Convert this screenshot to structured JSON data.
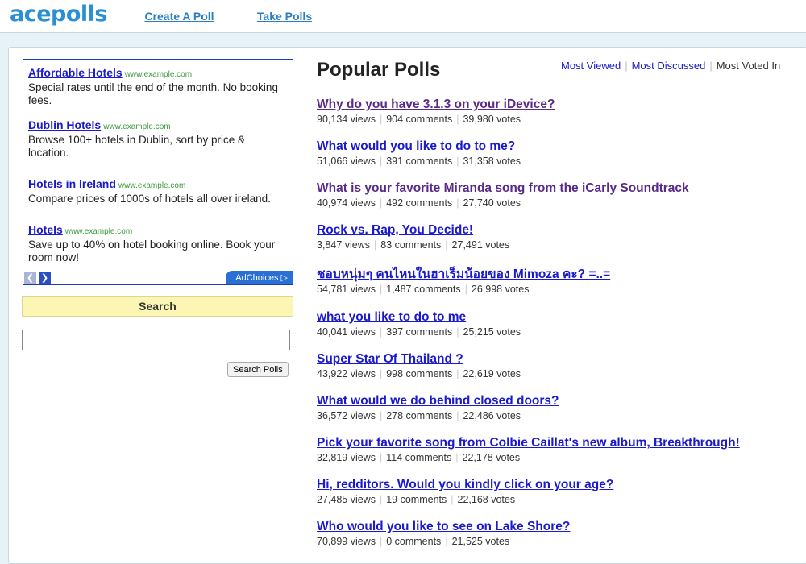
{
  "header": {
    "logo": "acepolls",
    "nav": [
      {
        "label": "Create A Poll"
      },
      {
        "label": "Take Polls"
      }
    ]
  },
  "ad": {
    "items": [
      {
        "title": "Affordable Hotels",
        "url": "www.example.com",
        "desc": "Special rates until the end of the month. No booking fees."
      },
      {
        "title": "Dublin Hotels",
        "url": "www.example.com",
        "desc": "Browse 100+ hotels in Dublin, sort by price & location."
      },
      {
        "title": "Hotels in Ireland",
        "url": "www.example.com",
        "desc": "Compare prices of 1000s of hotels all over ireland."
      },
      {
        "title": "Hotels",
        "url": "www.example.com",
        "desc": "Save up to 40% on hotel booking online. Book your room now!"
      }
    ],
    "adchoices": "AdChoices"
  },
  "search": {
    "heading": "Search",
    "input_value": "",
    "button_label": "Search Polls"
  },
  "main": {
    "title": "Popular Polls",
    "sort": {
      "most_viewed": "Most Viewed",
      "most_discussed": "Most Discussed",
      "most_voted": "Most Voted In"
    },
    "polls": [
      {
        "title": "Why do you have 3.1.3 on your iDevice?",
        "views": "90,134 views",
        "comments": "904 comments",
        "votes": "39,980 votes",
        "visited": true
      },
      {
        "title": "What would you like to do to me?",
        "views": "51,066 views",
        "comments": "391 comments",
        "votes": "31,358 votes",
        "visited": false
      },
      {
        "title": "What is your favorite Miranda song from the iCarly Soundtrack",
        "views": "40,974 views",
        "comments": "492 comments",
        "votes": "27,740 votes",
        "visited": true
      },
      {
        "title": "Rock vs. Rap, You Decide!",
        "views": "3,847 views",
        "comments": "83 comments",
        "votes": "27,491 votes",
        "visited": false
      },
      {
        "title": "ชอบหนุ่มๆ คนไหนในฮาเร็มน้อยของ Mimoza คะ? =..=",
        "views": "54,781 views",
        "comments": "1,487 comments",
        "votes": "26,998 votes",
        "visited": false
      },
      {
        "title": "what you like to do to me",
        "views": "40,041 views",
        "comments": "397 comments",
        "votes": "25,215 votes",
        "visited": false
      },
      {
        "title": "Super Star Of Thailand ?",
        "views": "43,922 views",
        "comments": "998 comments",
        "votes": "22,619 votes",
        "visited": false
      },
      {
        "title": "What would we do behind closed doors?",
        "views": "36,572 views",
        "comments": "278 comments",
        "votes": "22,486 votes",
        "visited": false
      },
      {
        "title": "Pick your favorite song from Colbie Caillat's new album, Breakthrough!",
        "views": "32,819 views",
        "comments": "114 comments",
        "votes": "22,178 votes",
        "visited": false
      },
      {
        "title": "Hi, redditors. Would you kindly click on your age?",
        "views": "27,485 views",
        "comments": "19 comments",
        "votes": "22,168 votes",
        "visited": false
      },
      {
        "title": "Who would you like to see on Lake Shore?",
        "views": "70,899 views",
        "comments": "0 comments",
        "votes": "21,525 votes",
        "visited": false
      }
    ]
  }
}
